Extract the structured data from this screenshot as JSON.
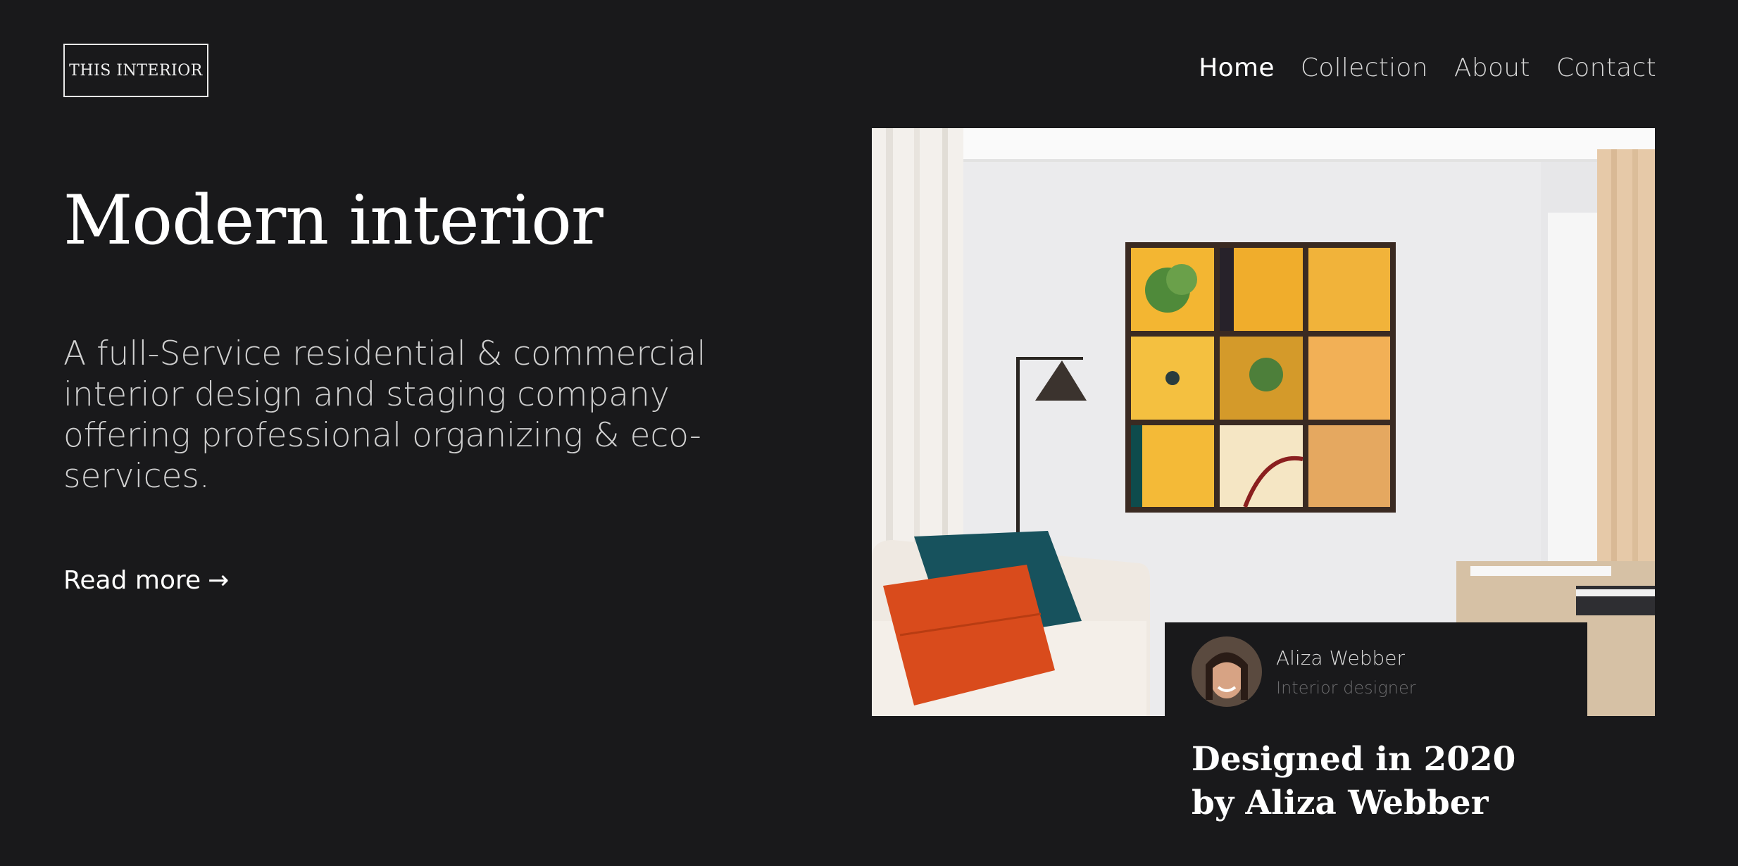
{
  "logo": {
    "text": "THIS INTERIOR"
  },
  "nav": {
    "items": [
      {
        "label": "Home",
        "active": true
      },
      {
        "label": "Collection",
        "active": false
      },
      {
        "label": "About",
        "active": false
      },
      {
        "label": "Contact",
        "active": false
      }
    ]
  },
  "hero": {
    "title": "Modern interior",
    "subtitle": "A full-Service residential & commercial interior design and staging company offering professional organizing & eco-services.",
    "read_more": "Read more",
    "read_more_icon": "→"
  },
  "card": {
    "designer_name": "Aliza Webber",
    "designer_role": "Interior designer",
    "title": "Designed in 2020 by Aliza Webber"
  },
  "colors": {
    "background": "#19191b",
    "text": "#ffffff",
    "muted": "#6d6d6f"
  }
}
